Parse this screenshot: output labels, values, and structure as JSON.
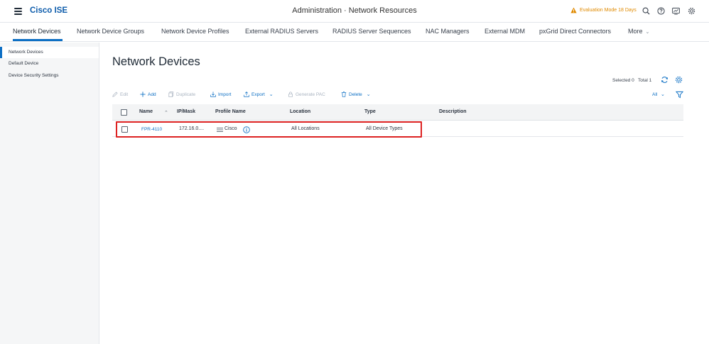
{
  "app": {
    "brand": "Cisco ISE",
    "page_title": "Administration · Network Resources",
    "evaluation": "Evaluation Mode 18 Days"
  },
  "tabs": [
    {
      "label": "Network Devices",
      "active": true
    },
    {
      "label": "Network Device Groups"
    },
    {
      "label": "Network Device Profiles"
    },
    {
      "label": "External RADIUS Servers"
    },
    {
      "label": "RADIUS Server Sequences"
    },
    {
      "label": "NAC Managers"
    },
    {
      "label": "External MDM"
    },
    {
      "label": "pxGrid Direct Connectors"
    },
    {
      "label": "More"
    }
  ],
  "sidebar": {
    "items": [
      {
        "label": "Network Devices",
        "active": true
      },
      {
        "label": "Default Device"
      },
      {
        "label": "Device Security Settings"
      }
    ]
  },
  "main": {
    "title": "Network Devices",
    "selected": "Selected 0",
    "total": "Total 1",
    "filter_label": "All"
  },
  "toolbar": {
    "edit": "Edit",
    "add": "Add",
    "duplicate": "Duplicate",
    "import": "Import",
    "export": "Export",
    "generate_pac": "Generate PAC",
    "delete": "Delete"
  },
  "table": {
    "columns": [
      "Name",
      "IP/Mask",
      "Profile Name",
      "Location",
      "Type",
      "Description"
    ],
    "rows": [
      {
        "name": "FPR-4110",
        "ip_mask": "172.16.0....",
        "profile": "Cisco",
        "location": "All Locations",
        "type": "All Device Types",
        "description": ""
      }
    ]
  },
  "colors": {
    "accent": "#0d6fc4",
    "warning": "#e08a00",
    "highlight": "#dd2222"
  },
  "icons": [
    "hamburger-icon",
    "warning-icon",
    "search-icon",
    "help-icon",
    "dashboard-icon",
    "gear-icon",
    "refresh-icon",
    "settings-icon",
    "filter-icon",
    "info-icon"
  ]
}
